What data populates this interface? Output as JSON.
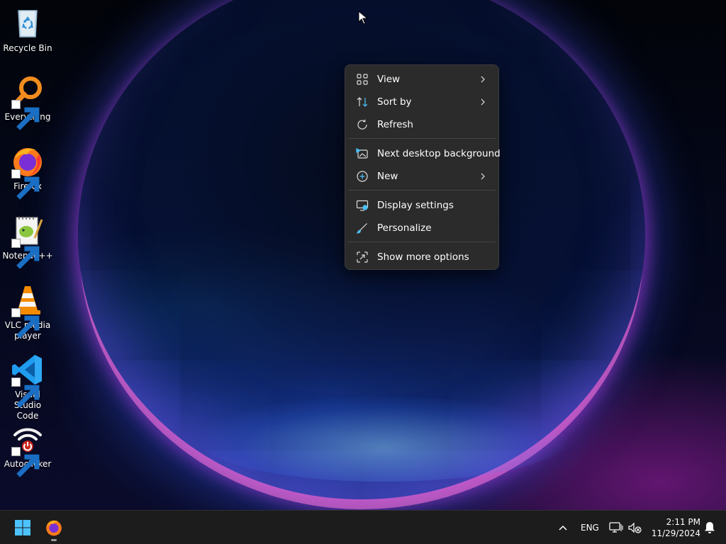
{
  "desktop": {
    "icons": [
      {
        "label": "Recycle Bin",
        "icon": "recycle-bin-icon",
        "shortcut": false
      },
      {
        "label": "Everything",
        "icon": "everything-search-icon",
        "shortcut": true
      },
      {
        "label": "Firefox",
        "icon": "firefox-icon",
        "shortcut": true
      },
      {
        "label": "Notepad++",
        "icon": "notepad-plus-plus-icon",
        "shortcut": true
      },
      {
        "label": "VLC media player",
        "icon": "vlc-cone-icon",
        "shortcut": true
      },
      {
        "label": "Visual Studio Code",
        "icon": "vscode-icon",
        "shortcut": true
      },
      {
        "label": "Autoclicker",
        "icon": "autoclicker-wifi-icon",
        "shortcut": true
      }
    ]
  },
  "context_menu": {
    "items": [
      {
        "label": "View",
        "icon": "grid-view-icon",
        "submenu": true
      },
      {
        "label": "Sort by",
        "icon": "sort-arrows-icon",
        "submenu": true
      },
      {
        "label": "Refresh",
        "icon": "refresh-icon",
        "submenu": false
      },
      {
        "label": "Next desktop background",
        "icon": "next-background-icon",
        "submenu": false
      },
      {
        "label": "New",
        "icon": "plus-circle-icon",
        "submenu": true
      },
      {
        "label": "Display settings",
        "icon": "display-settings-icon",
        "submenu": false
      },
      {
        "label": "Personalize",
        "icon": "brush-icon",
        "submenu": false
      },
      {
        "label": "Show more options",
        "icon": "show-more-icon",
        "submenu": false
      }
    ]
  },
  "taskbar": {
    "pinned": [
      {
        "name": "Start",
        "icon": "windows-start-icon"
      },
      {
        "name": "Firefox",
        "icon": "firefox-icon"
      }
    ],
    "tray": {
      "language": "ENG",
      "time": "2:11 PM",
      "date": "11/29/2024"
    }
  },
  "colors": {
    "menu_bg": "#2b2b2b",
    "taskbar_bg": "#1c1c1c",
    "accent": "#4cc2ff"
  }
}
